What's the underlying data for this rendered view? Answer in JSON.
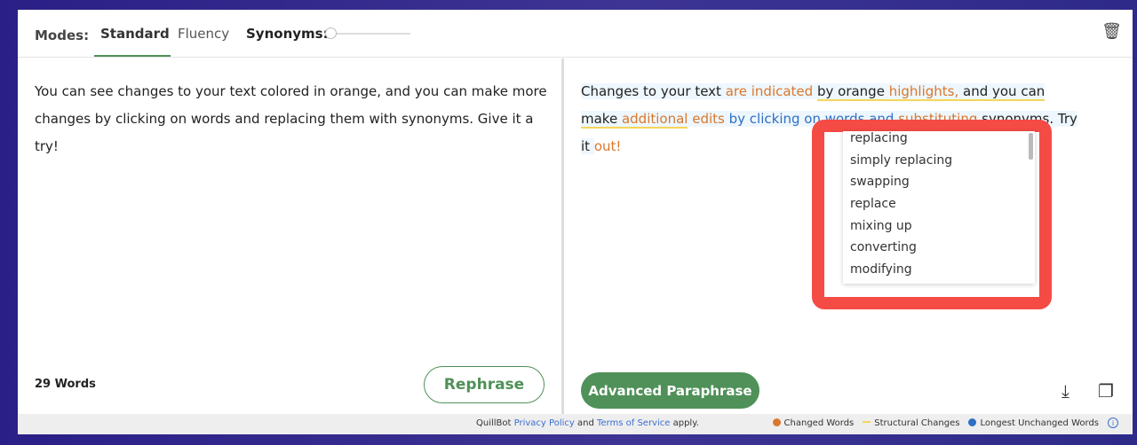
{
  "header": {
    "modes_label": "Modes:",
    "tabs": [
      {
        "label": "Standard",
        "active": true
      },
      {
        "label": "Fluency",
        "active": false
      }
    ],
    "synonyms_label": "Synonyms:",
    "synonyms_level": 0
  },
  "input": {
    "text": "You can see changes to your text colored in orange, and you can make more changes by clicking on words and replacing them with synonyms. Give it a try!",
    "word_count": "29 Words",
    "rephrase_label": "Rephrase"
  },
  "output": {
    "segments": [
      "Changes to your text ",
      "are indicated",
      " ",
      "by orange ",
      "highlights,",
      " and you can make ",
      "additional",
      " ",
      "edits",
      " ",
      "by clicking on words and",
      " ",
      "substituting",
      " synonyms. Try it ",
      "out!"
    ],
    "advanced_label": "Advanced Paraphrase"
  },
  "synonyms_dropdown": [
    "replacing",
    "simply replacing",
    "swapping",
    "replace",
    "mixing up",
    "converting",
    "modifying"
  ],
  "footer": {
    "prefix": "QuillBot",
    "privacy": "Privacy Policy",
    "and": "and",
    "terms": "Terms of Service",
    "suffix": "apply.",
    "legend": [
      {
        "label": "Changed Words",
        "color": "#d9772c"
      },
      {
        "label": "Structural Changes",
        "color": "#f4d55a"
      },
      {
        "label": "Longest Unchanged Words",
        "color": "#2f6fc4"
      }
    ]
  }
}
